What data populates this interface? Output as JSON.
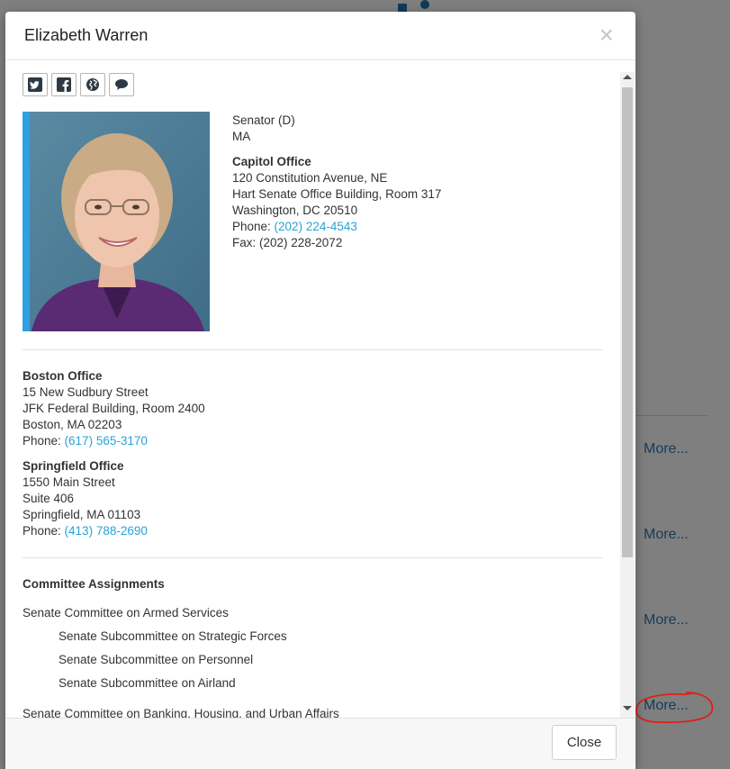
{
  "background": {
    "more_links": [
      "More...",
      "More...",
      "More...",
      "More..."
    ]
  },
  "modal": {
    "title": "Elizabeth Warren",
    "close_icon": "×",
    "social_icons": [
      "twitter-icon",
      "facebook-icon",
      "globe-icon",
      "chat-bubble-icon"
    ],
    "senator_line": "Senator (D)",
    "state": "MA",
    "capitol_office": {
      "heading": "Capitol Office",
      "line1": "120 Constitution Avenue, NE",
      "line2": "Hart Senate Office Building, Room 317",
      "line3": "Washington, DC 20510",
      "phone_label": "Phone: ",
      "phone": "(202) 224-4543",
      "fax": "Fax: (202) 228-2072"
    },
    "boston_office": {
      "heading": "Boston Office",
      "line1": "15 New Sudbury Street",
      "line2": "JFK Federal Building, Room 2400",
      "line3": "Boston, MA 02203",
      "phone_label": "Phone: ",
      "phone": "(617) 565-3170"
    },
    "springfield_office": {
      "heading": "Springfield Office",
      "line1": "1550 Main Street",
      "line2": "Suite 406",
      "line3": "Springfield, MA 01103",
      "phone_label": "Phone: ",
      "phone": "(413) 788-2690"
    },
    "committees": {
      "heading": "Committee Assignments",
      "items": [
        {
          "name": "Senate Committee on Armed Services",
          "level": 0
        },
        {
          "name": "Senate Subcommittee on Strategic Forces",
          "level": 1
        },
        {
          "name": "Senate Subcommittee on Personnel",
          "level": 1
        },
        {
          "name": "Senate Subcommittee on Airland",
          "level": 1
        },
        {
          "name": "Senate Committee on Banking, Housing, and Urban Affairs",
          "level": 0
        }
      ]
    },
    "footer": {
      "close_label": "Close"
    }
  },
  "colors": {
    "link": "#27a3d8",
    "photo_accent": "#2fa0e2",
    "annotation": "#e0201b"
  }
}
